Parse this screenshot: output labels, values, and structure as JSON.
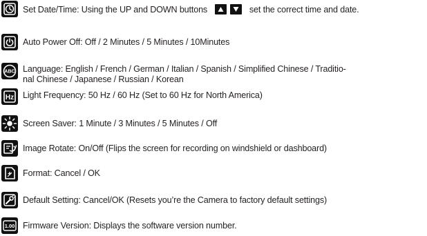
{
  "items": [
    {
      "icon": "clock-icon",
      "text_before": "Set Date/Time: Using the UP and DOWN buttons",
      "up_button_icon": "up-arrow-icon",
      "down_button_icon": "down-arrow-icon",
      "text_after": "set the correct time and date."
    },
    {
      "icon": "power-icon",
      "text": "Auto Power Off: Off / 2 Minutes / 5 Minutes / 10Minutes"
    },
    {
      "icon": "language-abc-icon",
      "text": "Language: English / French / German / Italian / Spanish / Simplified Chinese / Traditio-",
      "text2": "nal Chinese / Japanese / Russian / Korean"
    },
    {
      "icon": "hz-icon",
      "icon_label": "Hz",
      "text": "Light Frequency: 50 Hz / 60 Hz (Set to 60 Hz for North America)"
    },
    {
      "icon": "sun-screen-saver-icon",
      "text": "Screen Saver: 1 Minute / 3 Minutes / 5 Minutes / Off"
    },
    {
      "icon": "image-rotate-icon",
      "text": "Image Rotate: On/Off (Flips the screen for recording on windshield or dashboard)"
    },
    {
      "icon": "format-card-icon",
      "text": "Format: Cancel / OK"
    },
    {
      "icon": "default-setting-icon",
      "text": "Default Setting: Cancel/OK (Resets you’re the Camera to factory default settings)"
    },
    {
      "icon": "firmware-version-icon",
      "icon_label": "1.00",
      "text": "Firmware Version: Displays the software version number."
    }
  ],
  "colors": {
    "text": "#231f20",
    "icon_background": "#111111",
    "icon_foreground": "#ffffff"
  }
}
